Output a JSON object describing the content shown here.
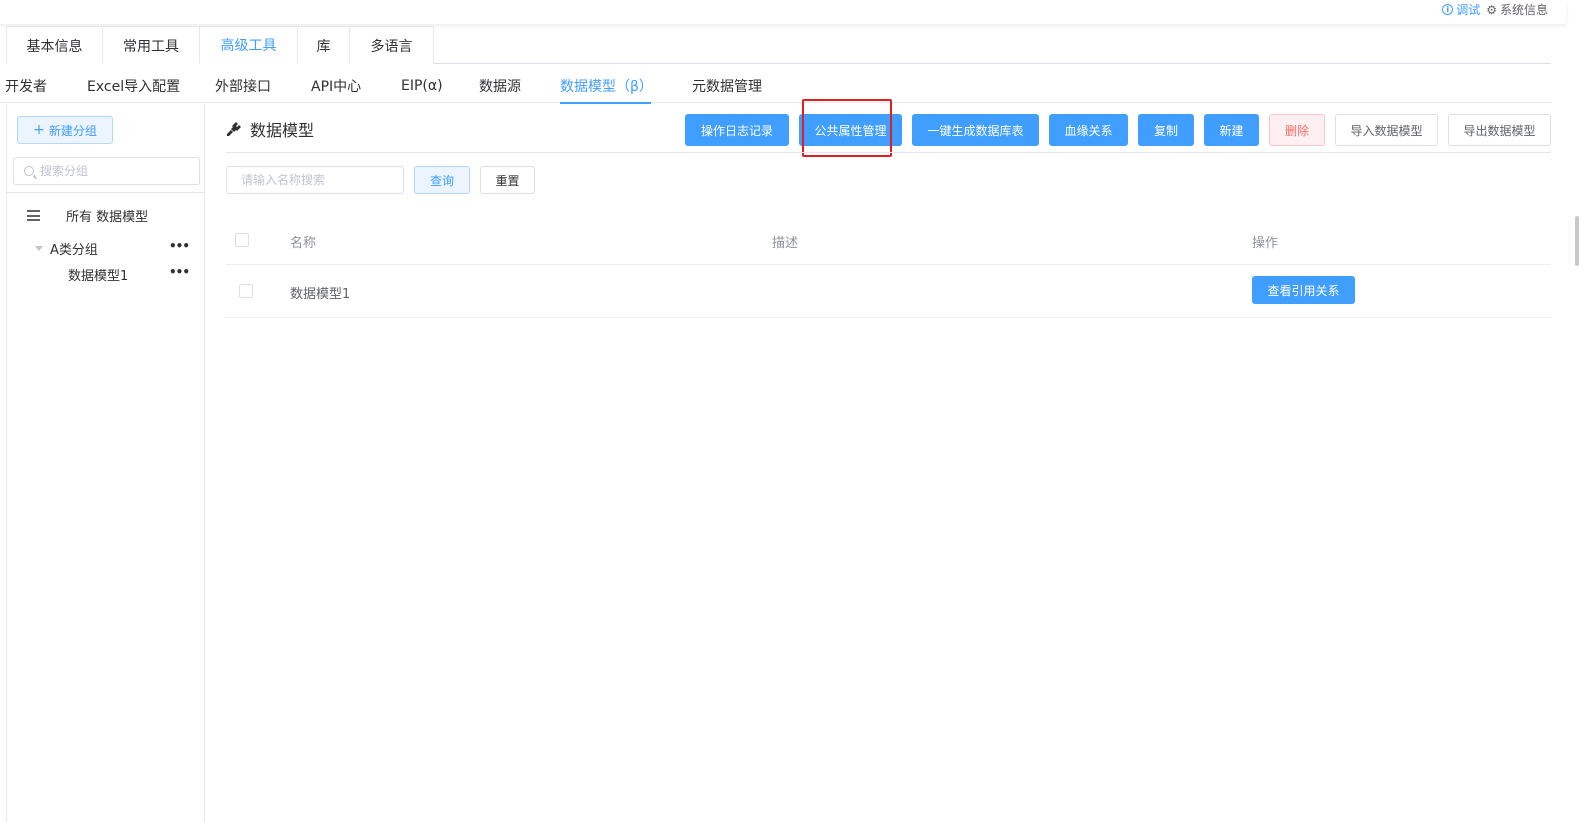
{
  "topbar": {
    "debug_label": "调试",
    "sys_label": "系统信息"
  },
  "main_tabs": [
    "基本信息",
    "常用工具",
    "高级工具",
    "库",
    "多语言"
  ],
  "sub_tabs": [
    "开发者",
    "Excel导入配置",
    "外部接口",
    "API中心",
    "EIP(α)",
    "数据源",
    "数据模型（β）",
    "元数据管理"
  ],
  "sidebar": {
    "new_group_label": "新建分组",
    "search_placeholder": "搜索分组",
    "all_label": "所有 数据模型",
    "group_label": "A类分组",
    "child_label": "数据模型1",
    "more_label": "•••"
  },
  "content": {
    "title": "数据模型",
    "buttons": {
      "log": "操作日志记录",
      "public_attr": "公共属性管理",
      "gen_table": "一键生成数据库表",
      "lineage": "血缘关系",
      "copy": "复制",
      "new": "新建",
      "delete": "删除",
      "import": "导入数据模型",
      "export": "导出数据模型"
    },
    "search_placeholder": "请输入名称搜索",
    "query_label": "查询",
    "reset_label": "重置",
    "table": {
      "headers": {
        "name": "名称",
        "desc": "描述",
        "ops": "操作"
      },
      "rows": [
        {
          "name": "数据模型1",
          "desc": "",
          "action": "查看引用关系"
        }
      ]
    }
  },
  "colors": {
    "primary": "#409eff",
    "danger": "#f56c6c",
    "highlight": "#e02020"
  }
}
